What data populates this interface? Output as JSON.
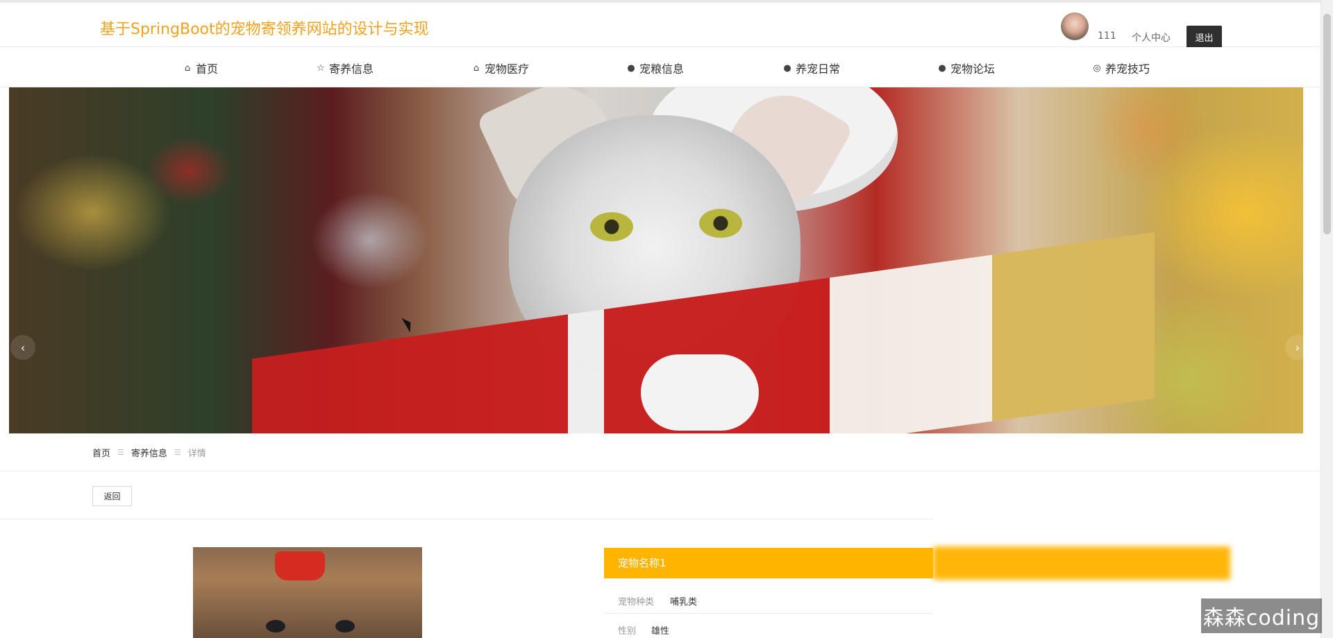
{
  "header": {
    "site_title": "基于SpringBoot的宠物寄领养网站的设计与实现",
    "username": "111",
    "personal_center": "个人中心",
    "logout": "退出"
  },
  "nav": {
    "items": [
      {
        "label": "首页",
        "icon": "home-icon",
        "glyph": "⌂"
      },
      {
        "label": "寄养信息",
        "icon": "star-icon",
        "glyph": "☆"
      },
      {
        "label": "宠物医疗",
        "icon": "bag-icon",
        "glyph": "⌂"
      },
      {
        "label": "宠粮信息",
        "icon": "alert-circle-icon",
        "glyph": "●"
      },
      {
        "label": "养宠日常",
        "icon": "help-circle-icon",
        "glyph": "●"
      },
      {
        "label": "宠物论坛",
        "icon": "info-circle-icon",
        "glyph": "●"
      },
      {
        "label": "养宠技巧",
        "icon": "target-icon",
        "glyph": "◎"
      }
    ]
  },
  "carousel": {
    "prev": "‹",
    "next": "›",
    "active_index": 2,
    "slides": 3
  },
  "breadcrumb": {
    "home": "首页",
    "section": "寄养信息",
    "current": "详情"
  },
  "actions": {
    "back": "返回"
  },
  "detail": {
    "title": "宠物名称1",
    "fields": [
      {
        "label": "宠物种类",
        "value": "哺乳类"
      },
      {
        "label": "性别",
        "value": "雄性"
      }
    ]
  },
  "watermark": "森森coding",
  "colors": {
    "brand": "#f0a21c",
    "accent": "#ffb400",
    "dark_button": "#2f2f2f"
  }
}
